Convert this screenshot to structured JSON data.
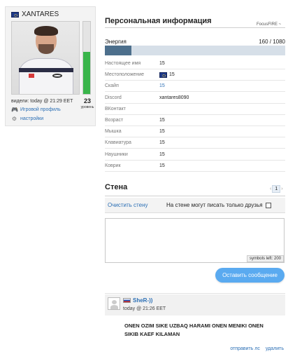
{
  "profile": {
    "username": "XANTARES",
    "country_flag": "eu-flag",
    "level": "23",
    "level_word": "уровень",
    "level_progress_percent": 58,
    "seen": "видели: today @ 21:29 EET",
    "game_profile_link": "Игровой профиль",
    "settings_link": "настройки"
  },
  "info": {
    "title": "Персональная информация",
    "focus_label": "FocusFIRE ~",
    "energy_label": "Энергия",
    "energy_value": "160 / 1080",
    "energy_fraction": 0.148,
    "rows": [
      {
        "key": "Настоящее имя",
        "value": "15"
      },
      {
        "key": "Местоположение",
        "value": "15",
        "flag": true
      },
      {
        "key": "Скайп",
        "value": "15",
        "link": true
      },
      {
        "key": "Discord",
        "value": "xantares8090"
      },
      {
        "key": "ВКонтакт",
        "value": ""
      },
      {
        "key": "Возраст",
        "value": "15"
      },
      {
        "key": "Мышка",
        "value": "15"
      },
      {
        "key": "Клавиатура",
        "value": "15"
      },
      {
        "key": "Наушники",
        "value": "15"
      },
      {
        "key": "Коврик",
        "value": "15"
      }
    ]
  },
  "wall": {
    "title": "Стена",
    "page_current": "1",
    "clear_label": "Очистить стену",
    "only_friends_label": "На стене могут писать только друзья",
    "textarea_placeholder": "",
    "symbols_left": "symbols left: 200",
    "post_button": "Оставить сообщение",
    "posts": [
      {
        "author": "SheR-))",
        "time": "today @ 21:26 EET",
        "text": "ONEN OZIM SIKE UZBAQ HARAMI ONEN MENIKI ONEN SIKIB KAEF KILAMAN",
        "reply_label": "отправить лс",
        "delete_label": "удалить"
      }
    ]
  },
  "colors": {
    "accent": "#2b6fb5",
    "level_green": "#39b54a",
    "energy_fill": "#4d6f8c",
    "button_blue": "#5aaaf0"
  }
}
